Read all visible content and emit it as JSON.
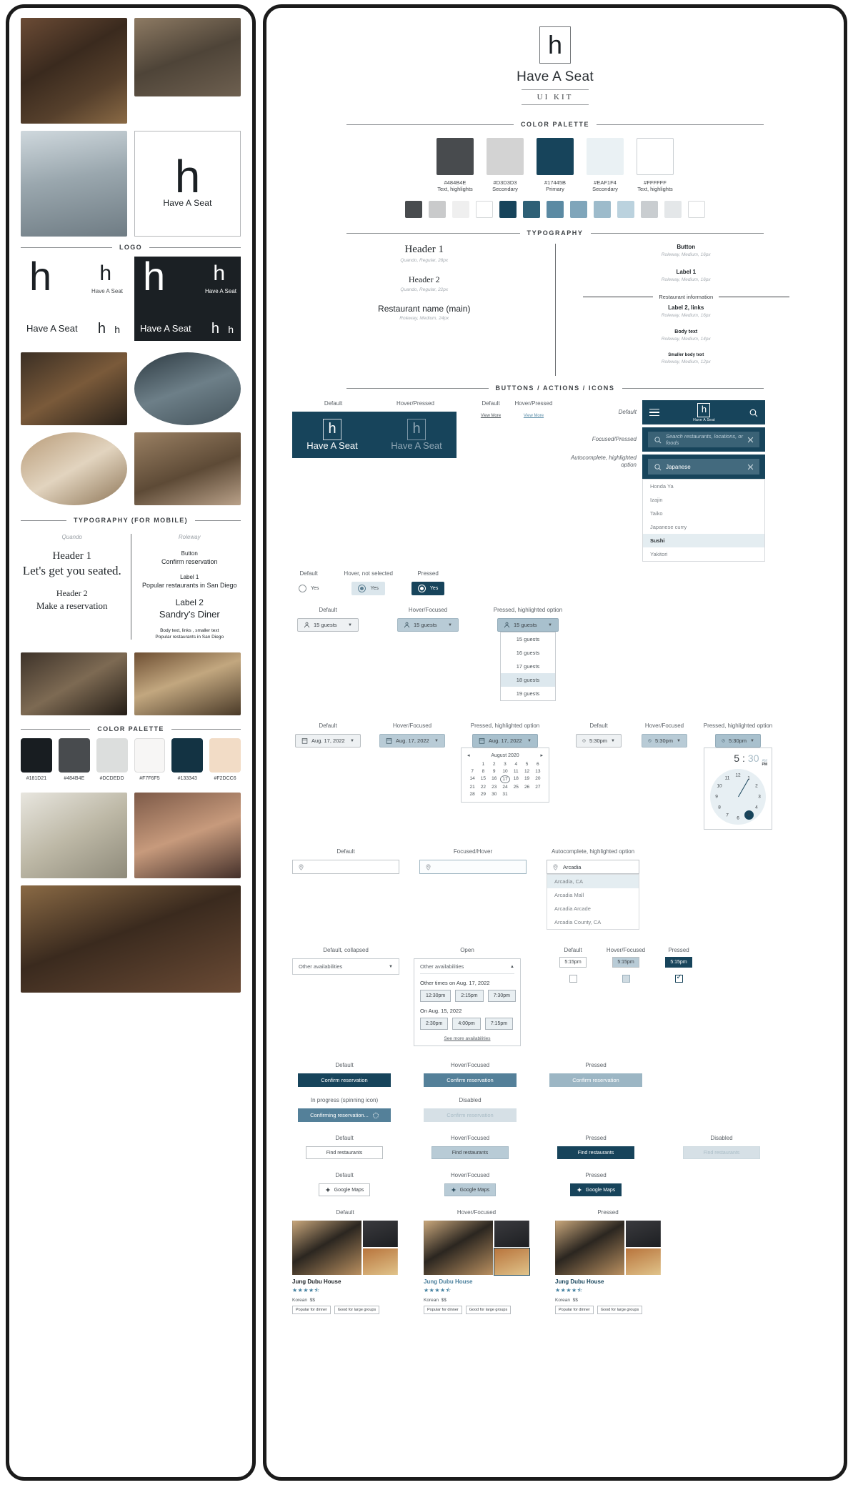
{
  "brand": {
    "logo_letter": "h",
    "name": "Have A Seat",
    "subtitle": "UI KIT"
  },
  "left_board": {
    "sections": {
      "logo": "LOGO",
      "typography_mobile": "TYPOGRAPHY (FOR MOBILE)",
      "color_palette": "COLOR PALETTE"
    },
    "logo_caption": "Have A Seat",
    "typography": {
      "serif_family": "Quando",
      "sans_family": "Roleway",
      "h1_label": "Header 1",
      "h1_sample": "Let's get you seated.",
      "h2_label": "Header 2",
      "h2_sample": "Make a reservation",
      "button_label": "Button",
      "button_sample": "Confirm reservation",
      "label1_label": "Label 1",
      "label1_sample": "Popular restaurants in San Diego",
      "label2_label": "Label 2",
      "label2_sample": "Sandry's Diner",
      "body_label": "Body text, links , smaller text",
      "body_sample": "Popular restaurants in San Diego"
    },
    "palette": [
      {
        "hex": "#181D21",
        "label": "#181D21"
      },
      {
        "hex": "#484B4E",
        "label": "#484B4E"
      },
      {
        "hex": "#DCDEDD",
        "label": "#DCDEDD"
      },
      {
        "hex": "#F7F6F5",
        "label": "#F7F6F5"
      },
      {
        "hex": "#133343",
        "label": "#133343"
      },
      {
        "hex": "#F2DCC6",
        "label": "#F2DCC6"
      }
    ]
  },
  "right_board": {
    "sections": {
      "color_palette": "COLOR PALETTE",
      "typography": "TYPOGRAPHY",
      "buttons": "BUTTONS / ACTIONS / ICONS"
    },
    "palette": [
      {
        "hex": "#484B4E",
        "label": "#484B4E",
        "use": "Text, highlights"
      },
      {
        "hex": "#D3D3D3",
        "label": "#D3D3D3",
        "use": "Secondary"
      },
      {
        "hex": "#17445B",
        "label": "#17445B",
        "use": "Primary"
      },
      {
        "hex": "#EAF1F4",
        "label": "#EAF1F4",
        "use": "Secondary"
      },
      {
        "hex": "#FFFFFF",
        "label": "#FFFFFF",
        "use": "Text, highlights"
      }
    ],
    "shades": [
      "#484B4E",
      "#C9CACB",
      "#EFEFEF",
      "#FFFFFF",
      "#17445B",
      "#2E6076",
      "#5B8AA3",
      "#7FA5BA",
      "#9DBBCB",
      "#BBD2DE",
      "#C9CDD0",
      "#E4E7E9",
      "#FFFFFF"
    ],
    "typography": {
      "h1_label": "Header 1",
      "h1_spec": "Quando, Regular, 28px",
      "h2_label": "Header 2",
      "h2_spec": "Quando, Regular, 22px",
      "restaurant_label": "Restaurant name (main)",
      "restaurant_spec": "Roleway, Medium, 24px",
      "button_label": "Button",
      "button_spec": "Roleway, Medium, 16px",
      "label1_label": "Label 1",
      "label1_spec": "Roleway, Medium, 16px",
      "info_divider": "Restaurant information",
      "label2_label": "Label 2, links",
      "label2_spec": "Roleway, Medium, 16px",
      "body_label": "Body text",
      "body_spec": "Roleway, Medium, 14px",
      "small_label": "Smaller body text",
      "small_spec": "Roleway, Medium, 12px"
    },
    "states": {
      "default": "Default",
      "hover_pressed": "Hover/Pressed",
      "hover_focused": "Hover/Focused",
      "pressed": "Pressed",
      "pressed_highlighted": "Pressed, highlighted option",
      "hover_not_selected": "Hover, not selected",
      "focused_pressed": "Focused/Pressed",
      "autocomplete_highlighted": "Autocomplete, highlighted option",
      "focused_hover": "Focused/Hover",
      "default_collapsed": "Default, collapsed",
      "open": "Open",
      "in_progress": "In progress (spinning icon)",
      "disabled": "Disabled"
    },
    "view_more": "View More",
    "nav": {
      "brand": "Have A Seat",
      "search_placeholder": "Search restaurants, locations, or foods",
      "query": "Japanese",
      "suggestions": [
        "Honda Ya",
        "Izajin",
        "Taiko",
        "Japanese curry",
        "Sushi",
        "Yakitori"
      ],
      "highlighted_suggestion": "Sushi"
    },
    "radio": {
      "label": "Yes"
    },
    "guests": {
      "value": "15 guests",
      "options": [
        "15 guests",
        "16 guests",
        "17 guests",
        "18 guests",
        "19 guests"
      ],
      "highlighted": "18 guests"
    },
    "date": {
      "value": "Aug. 17, 2022",
      "month": "August 2020",
      "prev": "◂",
      "next": "▸",
      "days": [
        "1",
        "2",
        "3",
        "4",
        "5",
        "6",
        "7",
        "8",
        "9",
        "10",
        "11",
        "12",
        "13",
        "14",
        "15",
        "16",
        "17",
        "18",
        "19",
        "20",
        "21",
        "22",
        "23",
        "24",
        "25",
        "26",
        "27",
        "28",
        "29",
        "30",
        "31"
      ],
      "selected_day": "17",
      "lead_blanks": 1
    },
    "time": {
      "value": "5:30pm",
      "hour": "5",
      "minute": "30",
      "am": "AM",
      "pm": "PM",
      "clock_numbers": [
        "12",
        "1",
        "2",
        "3",
        "4",
        "5",
        "6",
        "7",
        "8",
        "9",
        "10",
        "11"
      ],
      "selected": "5"
    },
    "location": {
      "query": "Arcadia",
      "suggestions": [
        "Arcadia, CA",
        "Arcadia Mall",
        "Arcadia Arcade",
        "Arcadia County, CA"
      ],
      "highlighted": "Arcadia, CA"
    },
    "availabilities": {
      "title": "Other availabilities",
      "group1_label": "Other times on Aug. 17, 2022",
      "group1_times": [
        "12:30pm",
        "2:15pm",
        "7:30pm"
      ],
      "group2_label": "On Aug. 15, 2022",
      "group2_times": [
        "2:30pm",
        "4:00pm",
        "7:15pm"
      ],
      "see_more": "See more availabilities"
    },
    "primary_button": {
      "label": "Confirm reservation",
      "progress_label": "Confirming reservation..."
    },
    "secondary_button": {
      "label": "Find restaurants"
    },
    "maps_button": {
      "label": "Google Maps"
    },
    "time_chips": [
      "5:15pm",
      "5:15pm",
      "5:15pm"
    ],
    "card": {
      "name": "Jung Dubu House",
      "stars": "★★★★",
      "half_star": "⯪",
      "cuisine": "Korean",
      "price": "$$",
      "tags": [
        "Popular for dinner",
        "Good for large groups"
      ]
    }
  }
}
